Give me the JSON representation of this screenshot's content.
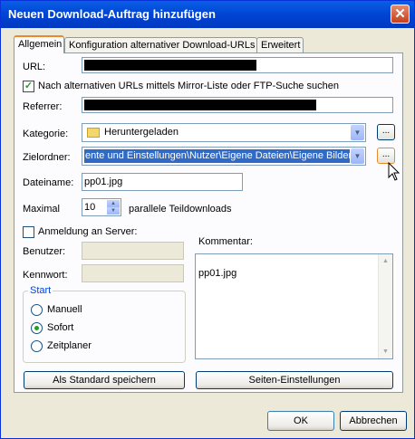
{
  "window": {
    "title": "Neuen Download-Auftrag hinzufügen",
    "close_glyph": "✕"
  },
  "tabs": [
    {
      "label": "Allgemein"
    },
    {
      "label": "Konfiguration alternativer Download-URLs"
    },
    {
      "label": "Erweitert"
    }
  ],
  "form": {
    "url_label": "URL:",
    "mirror_checkbox_label": "Nach alternativen URLs mittels Mirror-Liste oder FTP-Suche suchen",
    "mirror_checked": true,
    "referrer_label": "Referrer:",
    "category_label": "Kategorie:",
    "category_value": "Heruntergeladen",
    "target_label": "Zielordner:",
    "target_value": "ente und Einstellungen\\Nutzer\\Eigene Dateien\\Eigene Bilder",
    "browse_label": "...",
    "filename_label": "Dateiname:",
    "filename_value": "pp01.jpg",
    "maximal_label": "Maximal",
    "maximal_value": "10",
    "parallel_label": "parallele Teildownloads",
    "login_checkbox_label": "Anmeldung an Server:",
    "login_checked": false,
    "user_label": "Benutzer:",
    "password_label": "Kennwort:",
    "comment_label": "Kommentar:",
    "comment_value": "pp01.jpg"
  },
  "start_group": {
    "title": "Start",
    "options": [
      {
        "label": "Manuell",
        "selected": false
      },
      {
        "label": "Sofort",
        "selected": true
      },
      {
        "label": "Zeitplaner",
        "selected": false
      }
    ]
  },
  "buttons": {
    "save_default": "Als Standard speichern",
    "page_settings": "Seiten-Einstellungen",
    "ok": "OK",
    "cancel": "Abbrechen"
  },
  "colors": {
    "titlebar": "#0a5fe5",
    "selection": "#316ac5",
    "accent_tab": "#e68b2c"
  }
}
